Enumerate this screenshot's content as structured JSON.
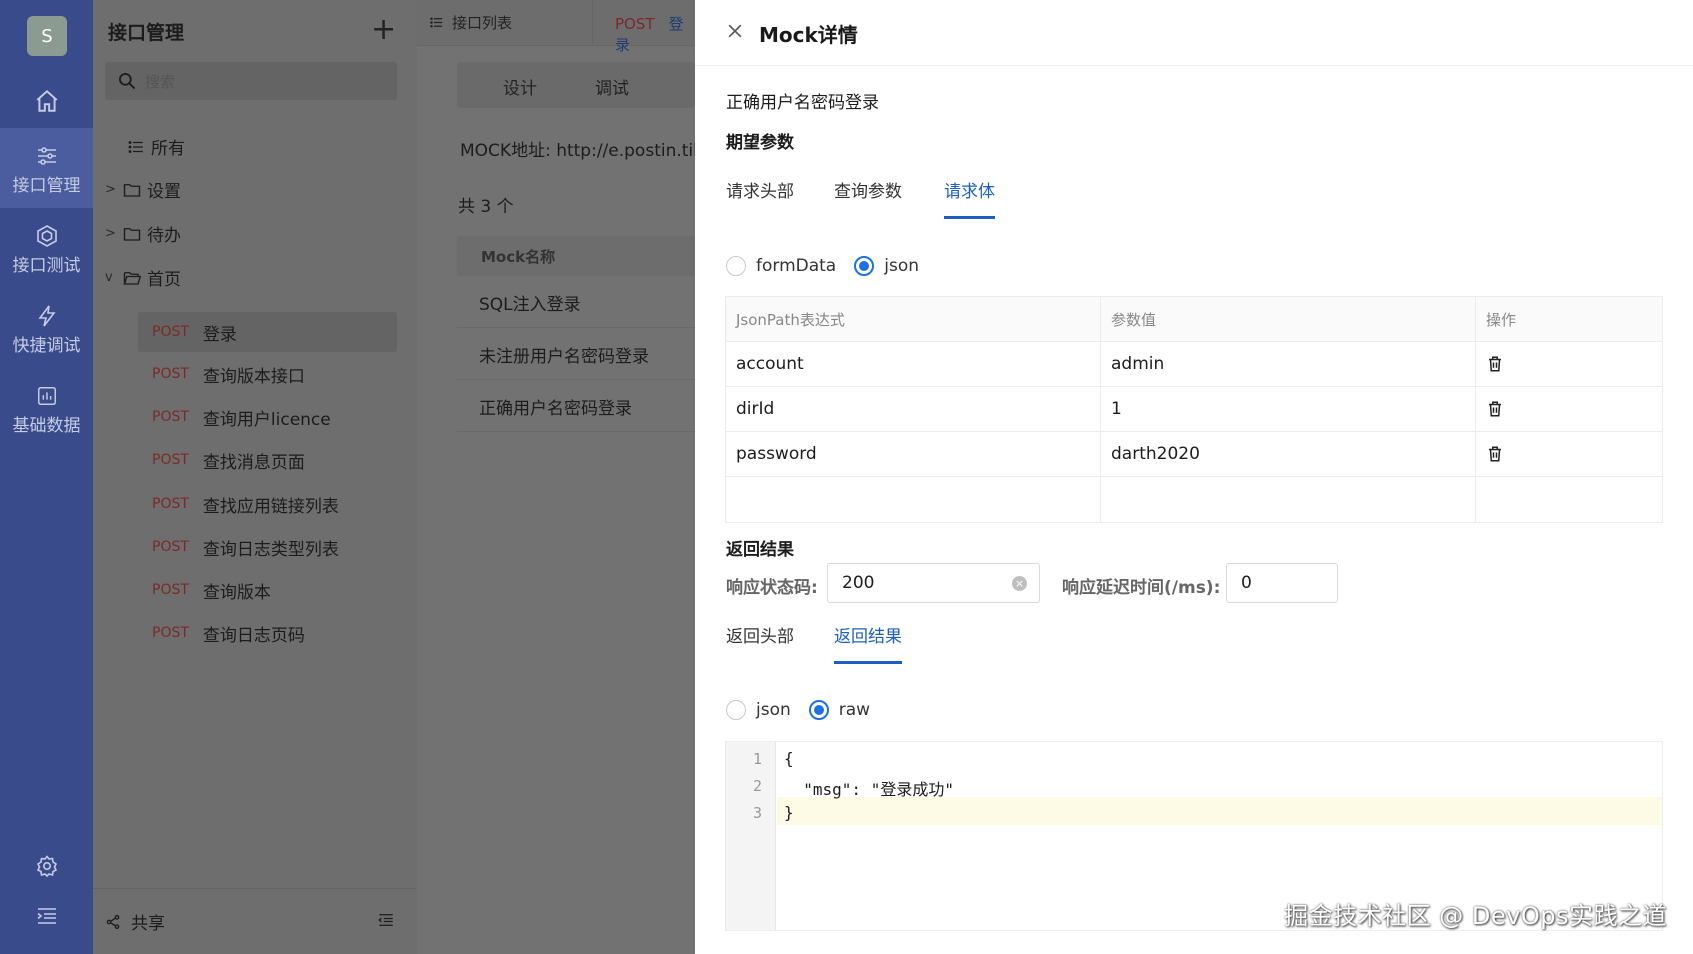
{
  "rail": {
    "avatar": "S",
    "items": [
      {
        "label": "接口管理",
        "icon": "sliders-icon",
        "active": true
      },
      {
        "label": "接口测试",
        "icon": "hexagon-icon",
        "active": false
      },
      {
        "label": "快捷调试",
        "icon": "lightning-icon",
        "active": false
      },
      {
        "label": "基础数据",
        "icon": "chart-icon",
        "active": false
      }
    ]
  },
  "tree": {
    "title": "接口管理",
    "add_icon": "plus-icon",
    "search_placeholder": "搜索",
    "all_label": "所有",
    "folders": [
      "设置",
      "待办",
      "首页"
    ],
    "method": "POST",
    "apis": [
      "登录",
      "查询版本接口",
      "查询用户licence",
      "查找消息页面",
      "查找应用链接列表",
      "查询日志类型列表",
      "查询版本",
      "查询日志页码"
    ],
    "share_label": "共享"
  },
  "mid": {
    "tab1_label": "接口列表",
    "tab2_method": "POST",
    "tab2_name": "登录",
    "seg_design": "设计",
    "seg_debug": "调试",
    "mock_addr": "MOCK地址: http://e.postin.tikl",
    "total": "共 3 个",
    "col_mock_name": "Mock名称",
    "rows": [
      "SQL注入登录",
      "未注册用户名密码登录",
      "正确用户名密码登录"
    ]
  },
  "drawer": {
    "title": "Mock详情",
    "mock_name": "正确用户名密码登录",
    "expect_title": "期望参数",
    "req_tabs": [
      "请求头部",
      "查询参数",
      "请求体"
    ],
    "req_active_tab": 2,
    "body_types": [
      "formData",
      "json"
    ],
    "body_type_selected": "json",
    "param_table": {
      "headers": [
        "JsonPath表达式",
        "参数值",
        "操作"
      ],
      "rows": [
        {
          "path": "account",
          "value": "admin"
        },
        {
          "path": "dirId",
          "value": "1"
        },
        {
          "path": "password",
          "value": "darth2020"
        }
      ]
    },
    "result_title": "返回结果",
    "status_label": "响应状态码:",
    "status_value": "200",
    "delay_label": "响应延迟时间(/ms):",
    "delay_value": "0",
    "resp_tabs": [
      "返回头部",
      "返回结果"
    ],
    "resp_active_tab": 1,
    "resp_types": [
      "json",
      "raw"
    ],
    "resp_type_selected": "raw",
    "code_lines": [
      "{",
      "  \"msg\": \"登录成功\"",
      "}"
    ]
  },
  "watermark": "掘金技术社区 @ DevOps实践之道"
}
